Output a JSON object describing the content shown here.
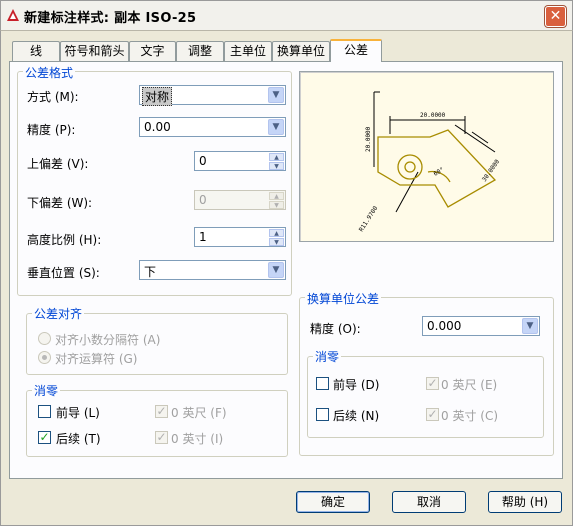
{
  "window": {
    "title": "新建标注样式: 副本 ISO-25",
    "close_glyph": "✕"
  },
  "tabs": [
    {
      "label": "线"
    },
    {
      "label": "符号和箭头"
    },
    {
      "label": "文字"
    },
    {
      "label": "调整"
    },
    {
      "label": "主单位"
    },
    {
      "label": "换算单位"
    },
    {
      "label": "公差"
    }
  ],
  "tolerance_format": {
    "legend": "公差格式",
    "method_label": "方式 (M):",
    "method_value": "对称",
    "precision_label": "精度 (P):",
    "precision_value": "0.00",
    "upper_label": "上偏差 (V):",
    "upper_value": "0",
    "lower_label": "下偏差 (W):",
    "lower_value": "0",
    "height_label": "高度比例 (H):",
    "height_value": "1",
    "vpos_label": "垂直位置 (S):",
    "vpos_value": "下"
  },
  "alignment": {
    "legend": "公差对齐",
    "opt1": "对齐小数分隔符 (A)",
    "opt2": "对齐运算符 (G)"
  },
  "zero_left": {
    "legend": "消零",
    "leading": "前导 (L)",
    "trailing": "后续 (T)",
    "feet": "0 英尺 (F)",
    "inches": "0 英寸 (I)"
  },
  "alt_tol": {
    "legend": "换算单位公差",
    "precision_label": "精度 (O):",
    "precision_value": "0.000",
    "zero_legend": "消零",
    "leading": "前导 (D)",
    "trailing": "后续 (N)",
    "feet": "0 英尺 (E)",
    "inches": "0 英寸 (C)"
  },
  "preview_labels": {
    "dim_vertical": "20.0000",
    "dim_top": "20.0000",
    "dim_right": "30.0000",
    "dim_diag": "R11.9700",
    "dim_angle": "60°"
  },
  "buttons": {
    "ok": "确定",
    "cancel": "取消",
    "help": "帮助 (H)"
  },
  "colors": {
    "accent": "#0046d5",
    "tab_highlight": "#f8b23a",
    "preview_bg": "#fffbe8"
  },
  "icons": {
    "combo_arrow": "▼",
    "spin_up": "▲",
    "spin_down": "▼",
    "check": "✓"
  }
}
